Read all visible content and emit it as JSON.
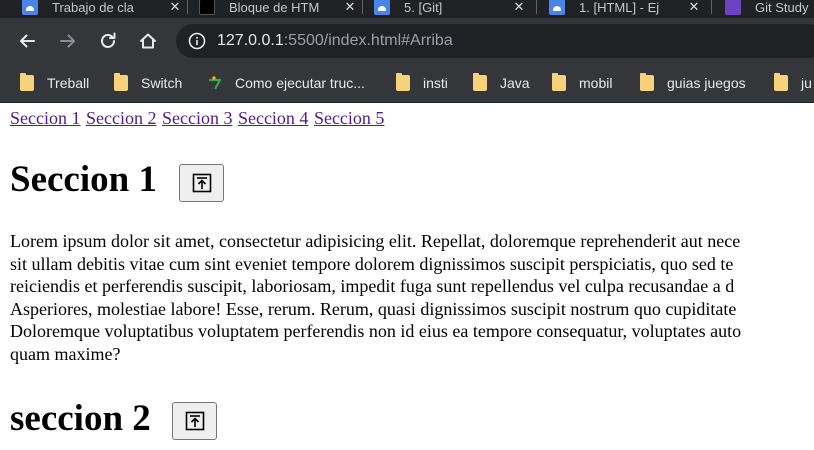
{
  "browser": {
    "tabs": [
      {
        "title": "Trabajo de cla",
        "favicon": "docs-icon"
      },
      {
        "title": "Bloque de HTM",
        "favicon": "codepen-icon"
      },
      {
        "title": "5. [Git]",
        "favicon": "docs-icon"
      },
      {
        "title": "1. [HTML] - Ej",
        "favicon": "docs-icon"
      },
      {
        "title": "Git Study",
        "favicon": "app-icon"
      }
    ],
    "url_host": "127.0.0.1",
    "url_rest": ":5500/index.html#Arriba"
  },
  "bookmarks": [
    "Treball",
    "Switch",
    "Como ejecutar truc...",
    "insti",
    "Java",
    "mobil",
    "guias juegos",
    "ju"
  ],
  "page": {
    "nav_links": [
      "Seccion 1",
      "Seccion 2",
      "Seccion 3",
      "Seccion 4",
      "Seccion 5"
    ],
    "section1": {
      "title": "Seccion 1",
      "paragraph_lines": [
        "Lorem ipsum dolor sit amet, consectetur adipisicing elit. Repellat, doloremque reprehenderit aut nece",
        "sit ullam debitis vitae cum sint eveniet tempore dolorem dignissimos suscipit perspiciatis, quo sed te",
        "reiciendis et perferendis suscipit, laboriosam, impedit fuga sunt repellendus vel culpa recusandae a d",
        "Asperiores, molestiae labore! Esse, rerum. Rerum, quasi dignissimos suscipit nostrum quo cupiditate",
        "Doloremque voluptatibus voluptatem perferendis non id eius ea tempore consequatur, voluptates auto",
        "quam maxime?"
      ]
    },
    "section2": {
      "title": "seccion 2"
    },
    "top_button_icon": "arrow-up-to-top-icon"
  },
  "colors": {
    "chrome_dark": "#202124",
    "chrome": "#35363a",
    "visited_link": "#551a8b",
    "folder": "#f6d37a"
  }
}
